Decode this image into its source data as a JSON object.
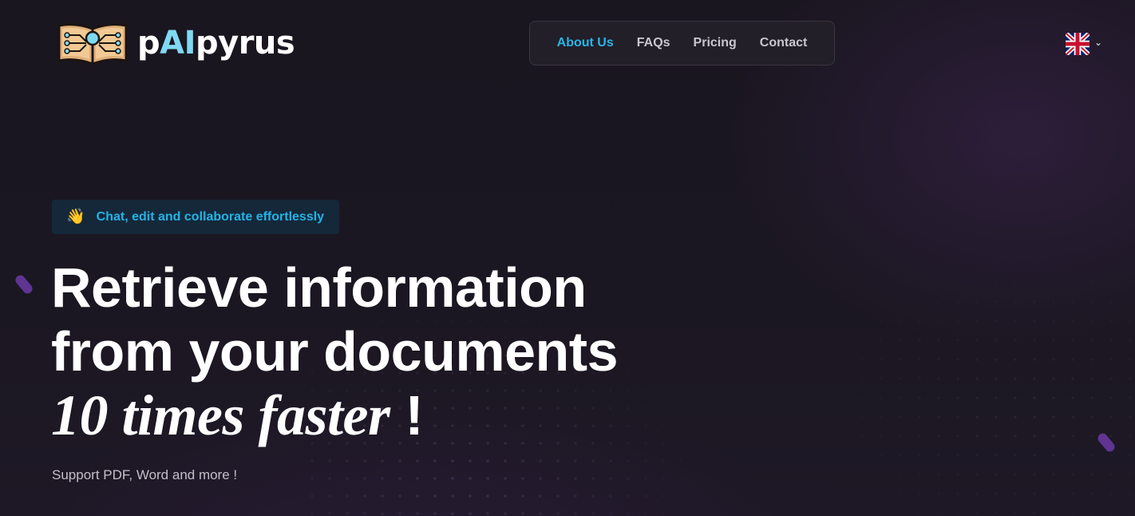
{
  "brand": {
    "name_prefix": "p",
    "name_highlight": "AI",
    "name_suffix": "pyrus"
  },
  "nav": {
    "items": [
      {
        "label": "About Us",
        "active": true
      },
      {
        "label": "FAQs",
        "active": false
      },
      {
        "label": "Pricing",
        "active": false
      },
      {
        "label": "Contact",
        "active": false
      }
    ]
  },
  "language": {
    "flag_icon": "uk-flag-icon",
    "chevron_icon": "chevron-down-icon"
  },
  "hero": {
    "badge_icon": "waving-hand-icon",
    "badge_emoji": "👋",
    "badge_text": "Chat, edit and collaborate effortlessly",
    "headline_line1": "Retrieve information",
    "headline_line2": "from your documents",
    "headline_line3": "10 times faster",
    "headline_exclaim": "!",
    "subtext": "Support PDF, Word and more !"
  },
  "colors": {
    "background": "#19151f",
    "accent": "#2ab4e6",
    "logo_ai": "#7fd9f2",
    "badge_bg": "#14283a",
    "nav_text": "#c9c6cf"
  }
}
